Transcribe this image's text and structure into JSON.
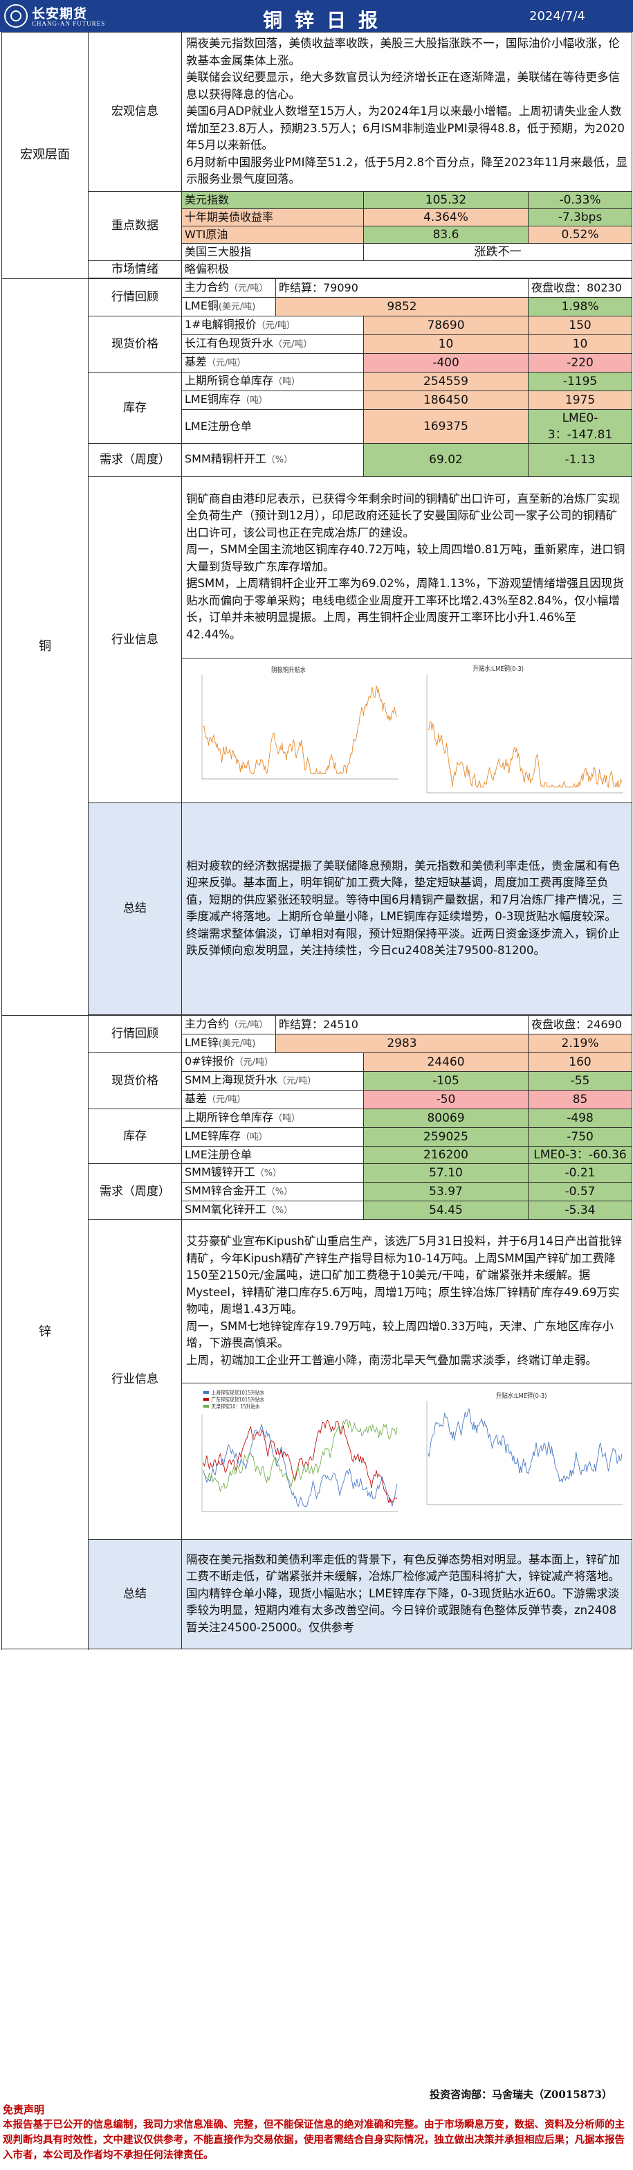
{
  "header": {
    "logo_cn": "长安期货",
    "logo_en": "CHANG-AN FUTURES",
    "title": "铜锌日报",
    "date": "2024/7/4"
  },
  "macro": {
    "section": "宏观层面",
    "info_label": "宏观信息",
    "info_lines": [
      "隔夜美元指数回落，美债收益率收跌，美股三大股指涨跌不一，国际油价小幅收涨，伦敦基本金属集体上涨。",
      "美联储会议纪要显示，绝大多数官员认为经济增长正在逐渐降温，美联储在等待更多信息以获得降息的信心。",
      "美国6月ADP就业人数增至15万人，为2024年1月以来最小增幅。上周初请失业金人数增加至23.8万人，预期23.5万人；6月ISM非制造业PMI录得48.8，低于预期，为2020年5月以来新低。",
      "6月财新中国服务业PMI降至51.2，低于5月2.8个百分点，降至2023年11月来最低，显示服务业景气度回落。"
    ],
    "key_label": "重点数据",
    "key_rows": [
      {
        "name": "美元指数",
        "value": "105.32",
        "change": "-0.33%"
      },
      {
        "name": "十年期美债收益率",
        "value": "4.364%",
        "change": "-7.3bps"
      },
      {
        "name": "WTI原油",
        "value": "83.6",
        "change": "0.52%"
      },
      {
        "name": "美国三大股指",
        "merged": "涨跌不一"
      }
    ],
    "sentiment_label": "市场情绪",
    "sentiment_value": "略偏积极"
  },
  "copper": {
    "section": "铜",
    "quote_label": "行情回顾",
    "main_contract": "主力合约",
    "main_unit": "（元/吨）",
    "prev_settle": "昨结算：79090",
    "night_close": "夜盘收盘：80230",
    "lme_name": "LME铜",
    "lme_unit": "(美元/吨)",
    "lme_value": "9852",
    "lme_change": "1.98%",
    "spot_label": "现货价格",
    "spot_rows": [
      {
        "name": "1#电解铜报价",
        "unit": "（元/吨）",
        "value": "78690",
        "change": "150"
      },
      {
        "name": "长江有色现货升水",
        "unit": "（元/吨）",
        "value": "10",
        "change": "10"
      },
      {
        "name": "基差",
        "unit": "（元/吨）",
        "value": "-400",
        "change": "-220"
      }
    ],
    "stock_label": "库存",
    "stock_rows": [
      {
        "name": "上期所铜仓单库存",
        "unit": "（吨）",
        "value": "254559",
        "change": "-1195"
      },
      {
        "name": "LME铜库存",
        "unit": "（吨）",
        "value": "186450",
        "change": "1975"
      },
      {
        "name": "LME注册仓单",
        "unit": "",
        "value": "169375",
        "change": "LME0-3：-147.81"
      }
    ],
    "demand_label": "需求（周度）",
    "demand_rows": [
      {
        "name": "SMM精铜杆开工",
        "unit": "（%）",
        "value": "69.02",
        "change": "-1.13"
      }
    ],
    "industry_label": "行业信息",
    "industry_lines": [
      "铜矿商自由港印尼表示，已获得今年剩余时间的铜精矿出口许可，直至新的冶炼厂实现全负荷生产（预计到12月），印尼政府还延长了安曼国际矿业公司一家子公司的铜精矿出口许可，该公司也正在完成冶炼厂的建设。",
      "周一，SMM全国主流地区铜库存40.72万吨，较上周四增0.81万吨，重新累库，进口铜大量到货导致广东库存增加。",
      "据SMM，上周精铜杆企业开工率为69.02%，周降1.13%，下游观望情绪增强且因现货贴水而偏向于零单采购；电线电缆企业周度开工率环比增2.43%至82.84%，仅小幅增长，订单并未被明显提振。上周，再生铜杆企业周度开工率环比小升1.46%至42.44%。"
    ],
    "chart1_title": "阴极铜升贴水",
    "chart2_title": "升贴水:LME铜(0-3)",
    "summary_label": "总结",
    "summary_text": "相对疲软的经济数据提振了美联储降息预期，美元指数和美债利率走低，贵金属和有色迎来反弹。基本面上，明年铜矿加工费大降，垫定短缺基调，周度加工费再度降至负值，短期的供应紧张还较明显。等待中国6月精铜产量数据，和7月冶炼厂排产情况，三季度减产将落地。上期所仓单量小降，LME铜库存延续增势，0-3现货贴水幅度较深。终端需求整体偏淡，订单相对有限，预计短期保持平淡。近两日资金逐步流入，铜价止跌反弹倾向愈发明显，关注持续性，今日cu2408关注79500-81200。"
  },
  "zinc": {
    "section": "锌",
    "quote_label": "行情回顾",
    "main_contract": "主力合约",
    "main_unit": "（元/吨）",
    "prev_settle": "昨结算：24510",
    "night_close": "夜盘收盘：24690",
    "lme_name": "LME锌",
    "lme_unit": "(美元/吨)",
    "lme_value": "2983",
    "lme_change": "2.19%",
    "spot_label": "现货价格",
    "spot_rows": [
      {
        "name": "0#锌报价",
        "unit": "（元/吨）",
        "value": "24460",
        "change": "160"
      },
      {
        "name": "SMM上海现货升水",
        "unit": "（元/吨）",
        "value": "-105",
        "change": "-55"
      },
      {
        "name": "基差",
        "unit": "（元/吨）",
        "value": "-50",
        "change": "85"
      }
    ],
    "stock_label": "库存",
    "stock_rows": [
      {
        "name": "上期所锌仓单库存",
        "unit": "（吨）",
        "value": "80069",
        "change": "-498"
      },
      {
        "name": "LME锌库存",
        "unit": "（吨）",
        "value": "259025",
        "change": "-750"
      },
      {
        "name": "LME注册仓单",
        "unit": "",
        "value": "216200",
        "change": "LME0-3：-60.36"
      }
    ],
    "demand_label": "需求（周度）",
    "demand_rows": [
      {
        "name": "SMM镀锌开工",
        "unit": "（%）",
        "value": "57.10",
        "change": "-0.21"
      },
      {
        "name": "SMM锌合金开工",
        "unit": "（%）",
        "value": "53.97",
        "change": "-0.57"
      },
      {
        "name": "SMM氧化锌开工",
        "unit": "（%）",
        "value": "54.45",
        "change": "-5.34"
      }
    ],
    "industry_label": "行业信息",
    "industry_lines": [
      "艾芬豪矿业宣布Kipush矿山重启生产，该选厂5月31日投料，并于6月14日产出首批锌精矿，今年Kipush精矿产锌生产指导目标为10-14万吨。上周SMM国产锌矿加工费降150至2150元/金属吨，进口矿加工费稳于10美元/干吨，矿端紧张并未缓解。据Mysteel，锌精矿港口库存5.6万吨，周增1万吨；原生锌冶炼厂锌精矿库存49.69万实物吨，周增1.43万吨。",
      "周一，SMM七地锌锭库存19.79万吨，较上周四增0.33万吨，天津、广东地区库存小增，下游畏高慎采。",
      "上周，初端加工企业开工普遍小降，南涝北旱天气叠加需求淡季，终端订单走弱。"
    ],
    "chart1_legend": [
      "上海锌锭现货1015升贴水",
      "广东锌锭现货1015升贴水",
      "天津锌锭10：15升贴水"
    ],
    "chart2_title": "升贴水:LME锌(0-3)",
    "summary_label": "总结",
    "summary_text": "隔夜在美元指数和美债利率走低的背景下，有色反弹态势相对明显。基本面上，锌矿加工费不断走低，矿端紧张并未缓解，冶炼厂检修减产范围科将扩大，锌锭减产将落地。国内精锌仓单小降，现货小幅贴水；LME锌库存下降，0-3现货贴水近60。下游需求淡季较为明显，短期内难有太多改善空间。今日锌价或跟随有色整体反弹节奏，zn2408暂关注24500-25000。仅供参考"
  },
  "footer": {
    "investor": "投资咨询部：马舍瑞夫（Z0015873）",
    "disclaimer_title": "免责声明",
    "disclaimer": "本报告基于已公开的信息编制，我司力求信息准确、完整，但不能保证信息的绝对准确和完整。由于市场瞬息万变，数据、资料及分析师的主观判断均具有时效性，文中建议仅供参考，不能直接作为交易依据，使用者需结合自身实际情况，独立做出决策并承担相应后果；凡据本报告入市者，本公司及作者均不承担任何法律责任。"
  },
  "colors": {
    "header_bg": "#1c3f8e",
    "summary_bg": "#dce6f4",
    "orange_cell": "#f8cbad",
    "green_cell": "#a9d08e",
    "red_cell": "#f8b1b1",
    "disclaimer_red": "#c00000",
    "chart_orange": "#e8821c",
    "chart_blue": "#4472c4"
  }
}
